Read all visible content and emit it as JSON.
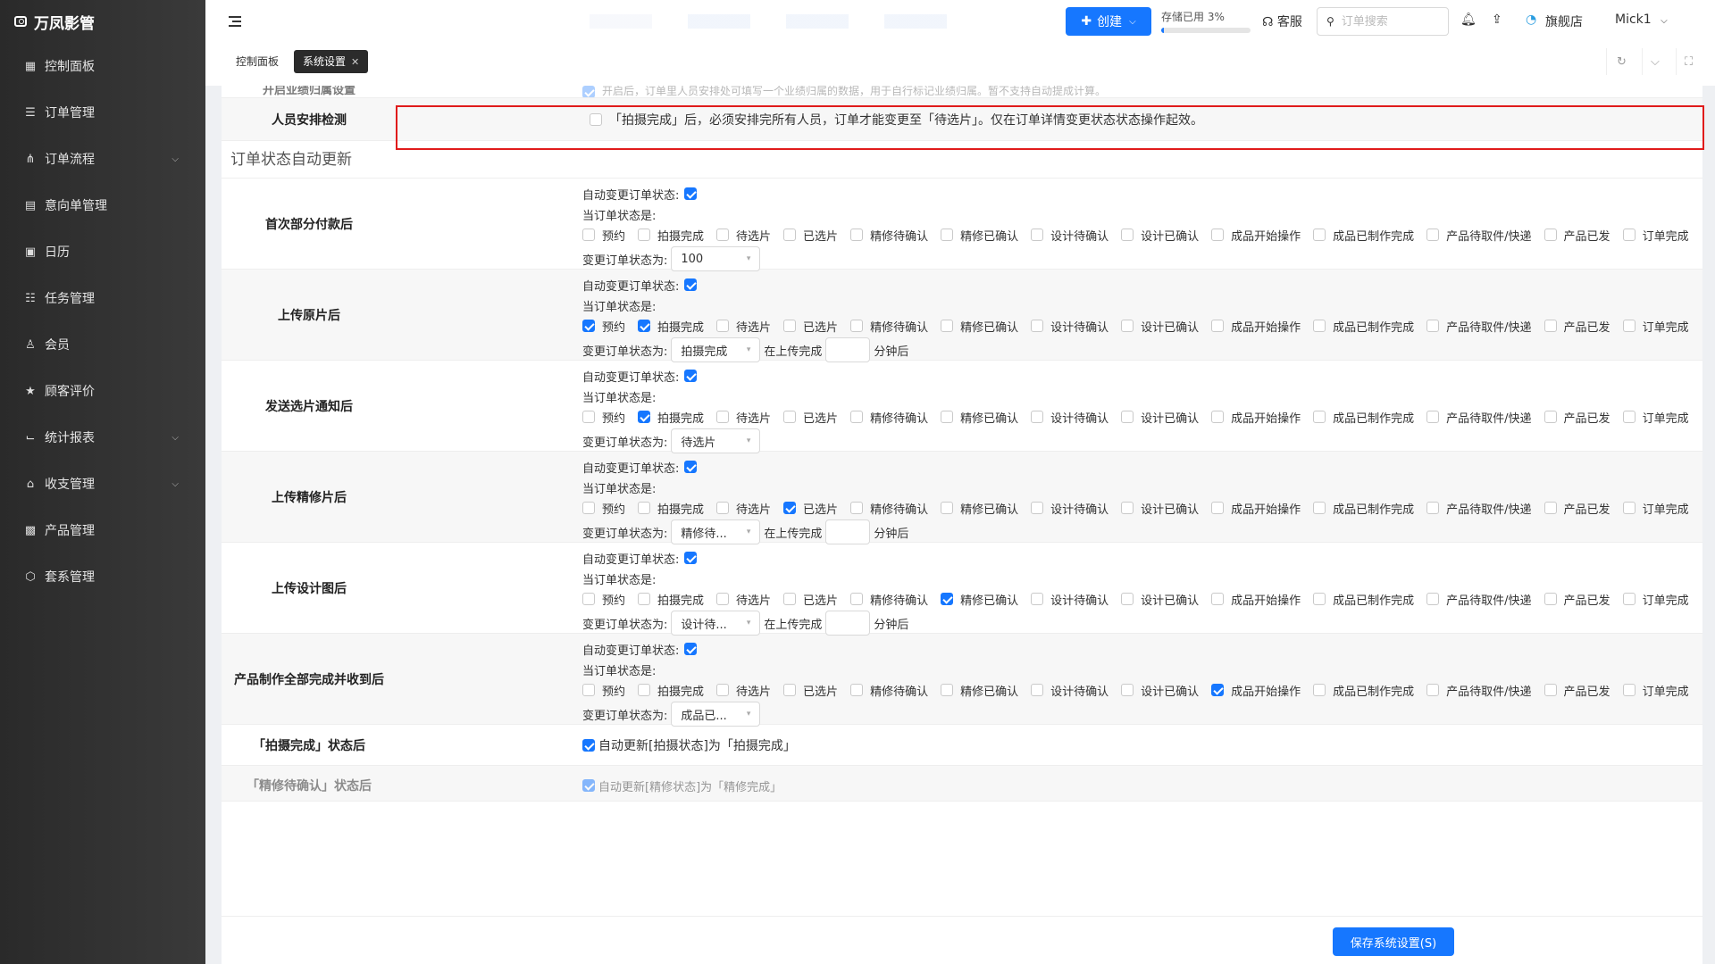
{
  "app": {
    "name": "万凤影管"
  },
  "sidebar": {
    "items": [
      {
        "label": "控制面板",
        "icon": "dashboard-icon"
      },
      {
        "label": "订单管理",
        "icon": "list-icon"
      },
      {
        "label": "订单流程",
        "icon": "flow-icon",
        "has_chevron": true
      },
      {
        "label": "意向单管理",
        "icon": "document-icon"
      },
      {
        "label": "日历",
        "icon": "calendar-icon"
      },
      {
        "label": "任务管理",
        "icon": "task-icon"
      },
      {
        "label": "会员",
        "icon": "user-icon"
      },
      {
        "label": "顾客评价",
        "icon": "star-icon"
      },
      {
        "label": "统计报表",
        "icon": "chart-icon",
        "has_chevron": true
      },
      {
        "label": "收支管理",
        "icon": "bank-icon",
        "has_chevron": true
      },
      {
        "label": "产品管理",
        "icon": "grid-icon"
      },
      {
        "label": "套系管理",
        "icon": "package-icon"
      }
    ]
  },
  "topbar": {
    "create_label": "创建",
    "storage_label": "存储已用 3%",
    "storage_percent": 3,
    "support_label": "客服",
    "search_placeholder": "订单搜索",
    "store_label": "旗舰店",
    "user_label": "Mick1"
  },
  "tabs": [
    {
      "label": "控制面板",
      "active": false
    },
    {
      "label": "系统设置",
      "active": true
    }
  ],
  "content": {
    "partial_top_label": "开启业绩归属设置",
    "partial_top_text": "开启后，订单里人员安排处可填写一个业绩归属的数据，用于自行标记业绩归属。暂不支持自动提成计算。",
    "staff_check": {
      "label": "人员安排检测",
      "text": "「拍摄完成」后，必须安排完所有人员，订单才能变更至「待选片」。仅在订单详情变更状态状态操作起效。",
      "checked": false
    },
    "section_title": "订单状态自动更新",
    "auto_change_label": "自动变更订单状态:",
    "current_status_label": "当订单状态是:",
    "change_to_label": "变更订单状态为:",
    "after_upload_label": "在上传完成",
    "minutes_label": "分钟后",
    "statuses": [
      "预约",
      "拍摄完成",
      "待选片",
      "已选片",
      "精修待确认",
      "精修已确认",
      "设计待确认",
      "设计已确认",
      "成品开始操作",
      "成品已制作完成",
      "产品待取件/快递",
      "产品已发",
      "订单完成"
    ],
    "rules": [
      {
        "label": "首次部分付款后",
        "auto": true,
        "checked": [],
        "target": "100",
        "has_delay": false
      },
      {
        "label": "上传原片后",
        "auto": true,
        "checked": [
          0,
          1
        ],
        "target": "拍摄完成",
        "has_delay": true
      },
      {
        "label": "发送选片通知后",
        "auto": true,
        "checked": [
          1
        ],
        "target": "待选片",
        "has_delay": false
      },
      {
        "label": "上传精修片后",
        "auto": true,
        "checked": [
          3
        ],
        "target": "精修待...",
        "has_delay": true
      },
      {
        "label": "上传设计图后",
        "auto": true,
        "checked": [
          5
        ],
        "target": "设计待...",
        "has_delay": true
      },
      {
        "label": "产品制作全部完成并收到后",
        "auto": true,
        "checked": [
          8
        ],
        "target": "成品已...",
        "has_delay": false
      }
    ],
    "shoot_done": {
      "label": "「拍摄完成」状态后",
      "text": "自动更新[拍摄状态]为「拍摄完成」",
      "checked": true
    },
    "partial_bottom_label": "「精修待确认」状态后",
    "partial_bottom_text": "自动更新[精修状态]为「精修完成」"
  },
  "footer": {
    "save_label": "保存系统设置(S)"
  }
}
